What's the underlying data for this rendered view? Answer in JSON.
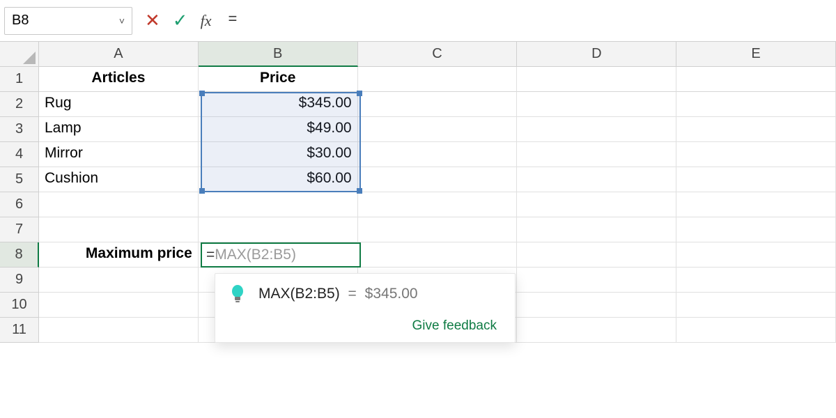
{
  "colors": {
    "accent_green": "#0f7b44",
    "range_blue": "#4a7ebb",
    "cancel_red": "#c0392b"
  },
  "formula_bar": {
    "cell_ref": "B8",
    "formula_text": "=",
    "fx_label": "fx"
  },
  "icons": {
    "cancel": "✕",
    "accept": "✓",
    "dropdown": "˅"
  },
  "columns": [
    "A",
    "B",
    "C",
    "D",
    "E"
  ],
  "rows": [
    "1",
    "2",
    "3",
    "4",
    "5",
    "6",
    "7",
    "8",
    "9",
    "10",
    "11"
  ],
  "active_cell": "B8",
  "grid": {
    "A1": "Articles",
    "B1": "Price",
    "A2": "Rug",
    "B2": "$345.00",
    "A3": "Lamp",
    "B3": "$49.00",
    "A4": "Mirror",
    "B4": "$30.00",
    "A5": "Cushion",
    "B5": "$60.00",
    "A8": "Maximum price"
  },
  "editing": {
    "typed": "=",
    "ghost_suggestion": "MAX(B2:B5)"
  },
  "range_selection": "B2:B5",
  "suggestion": {
    "expression": "MAX(B2:B5)",
    "equals": "=",
    "result": "$345.00",
    "feedback_link": "Give feedback"
  },
  "chart_data": {
    "type": "table",
    "title": "",
    "columns": [
      "Articles",
      "Price"
    ],
    "rows": [
      {
        "Articles": "Rug",
        "Price": 345.0
      },
      {
        "Articles": "Lamp",
        "Price": 49.0
      },
      {
        "Articles": "Mirror",
        "Price": 30.0
      },
      {
        "Articles": "Cushion",
        "Price": 60.0
      }
    ],
    "derived": {
      "label": "Maximum price",
      "formula": "MAX(B2:B5)",
      "value": 345.0
    }
  }
}
